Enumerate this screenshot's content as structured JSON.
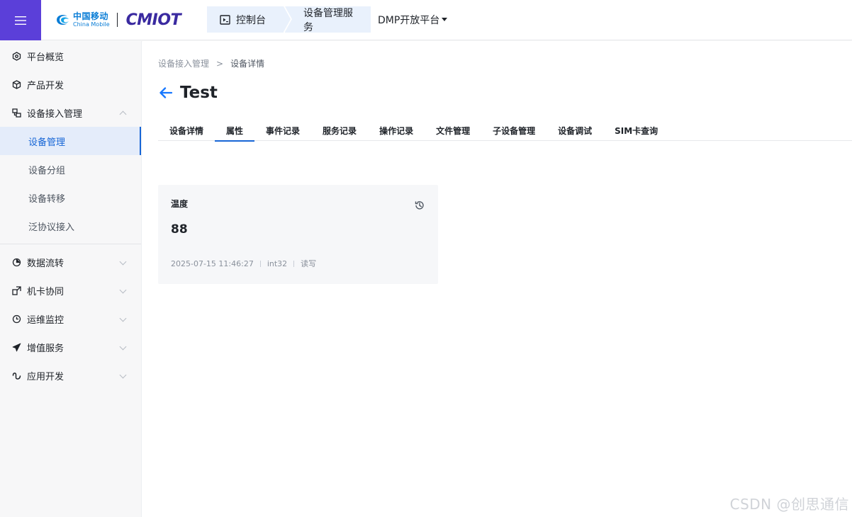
{
  "topbar": {
    "brand_cn": "中国移动",
    "brand_en": "China Mobile",
    "product_logo": "CMIOT",
    "crumb_tabs": [
      {
        "label": "控制台",
        "icon": "console-icon"
      },
      {
        "label": "设备管理服务"
      }
    ],
    "platform_label": "DMP开放平台",
    "accent": "#5b3fd9"
  },
  "sidebar": {
    "items": [
      {
        "label": "平台概览",
        "icon": "overview-icon"
      },
      {
        "label": "产品开发",
        "icon": "cube-icon"
      },
      {
        "label": "设备接入管理",
        "icon": "device-access-icon",
        "expanded": true,
        "children": [
          {
            "label": "设备管理",
            "active": true
          },
          {
            "label": "设备分组"
          },
          {
            "label": "设备转移"
          },
          {
            "label": "泛协议接入"
          }
        ]
      },
      {
        "label": "数据流转",
        "icon": "data-flow-icon"
      },
      {
        "label": "机卡协同",
        "icon": "sim-link-icon"
      },
      {
        "label": "运维监控",
        "icon": "monitor-icon"
      },
      {
        "label": "增值服务",
        "icon": "send-icon"
      },
      {
        "label": "应用开发",
        "icon": "app-dev-icon"
      }
    ],
    "active_color": "#1766d6"
  },
  "main": {
    "breadcrumb": {
      "parent": "设备接入管理",
      "separator": ">",
      "current": "设备详情"
    },
    "title": "Test",
    "tabs": [
      "设备详情",
      "属性",
      "事件记录",
      "服务记录",
      "操作记录",
      "文件管理",
      "子设备管理",
      "设备调试",
      "SIM卡查询"
    ],
    "active_tab": "属性",
    "property_card": {
      "label": "温度",
      "value": "88",
      "timestamp": "2025-07-15 11:46:27",
      "data_type": "int32",
      "access": "读写"
    }
  },
  "watermark": "CSDN @创思通信"
}
